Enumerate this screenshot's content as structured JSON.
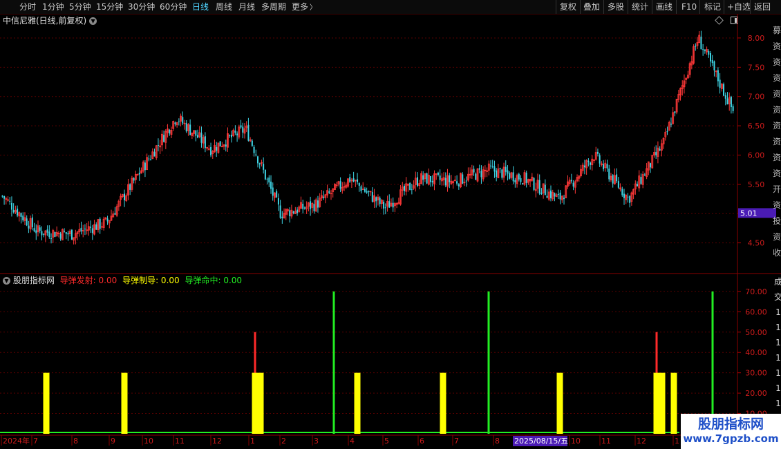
{
  "toolbar": {
    "periods": [
      "分时",
      "1分钟",
      "5分钟",
      "15分钟",
      "30分钟",
      "60分钟",
      "日线",
      "周线",
      "月线",
      "多周期",
      "更多"
    ],
    "active_period": "日线",
    "right_buttons": [
      "复权",
      "叠加",
      "多股",
      "统计",
      "画线",
      "F10",
      "标记",
      "+自选",
      "返回"
    ]
  },
  "main_chart": {
    "title": "中信尼雅(日线,前复权)",
    "current_price_tag": "5.01",
    "price_axis_labels": [
      "8.00",
      "7.50",
      "7.00",
      "6.50",
      "6.00",
      "5.50",
      "5.00",
      "4.50"
    ],
    "right_edge_glyphs": [
      "募",
      "资",
      "资",
      "资",
      "资",
      "资",
      "资",
      "资",
      "资",
      "资",
      "开",
      "资",
      "投",
      "资",
      "收"
    ]
  },
  "indicator": {
    "name": "股朋指标网",
    "lines": [
      {
        "label": "导弹发射: 0.00",
        "color": "#ff2a2a"
      },
      {
        "label": "导弹制导: 0.00",
        "color": "#ffff00"
      },
      {
        "label": "导弹命中: 0.00",
        "color": "#22ee22"
      }
    ],
    "axis_labels": [
      "70.00",
      "60.00",
      "50.00",
      "40.00",
      "30.00",
      "20.00",
      "10.00"
    ],
    "right_edge_glyphs": [
      "成",
      "交",
      "1",
      "1",
      "1",
      "1",
      "1",
      "1",
      "1",
      "1",
      "1"
    ]
  },
  "time_axis": {
    "labels": [
      "2024年",
      "7",
      "8",
      "9",
      "10",
      "11",
      "12",
      "1",
      "2",
      "3",
      "4",
      "5",
      "6",
      "7",
      "8",
      "9",
      "10",
      "11",
      "12",
      "1"
    ],
    "cursor_date": "2025/08/15/五"
  },
  "chart_data": [
    {
      "type": "candlestick",
      "title": "中信尼雅(日线,前复权)",
      "ylim": [
        4.0,
        8.2
      ],
      "approx_close_path": [
        {
          "t": "2024-06",
          "v": 5.3
        },
        {
          "t": "2024-07",
          "v": 4.7
        },
        {
          "t": "2024-08",
          "v": 4.65
        },
        {
          "t": "2024-09",
          "v": 4.85
        },
        {
          "t": "2024-10",
          "v": 5.75
        },
        {
          "t": "2024-10-end",
          "v": 6.65
        },
        {
          "t": "2024-11",
          "v": 6.1
        },
        {
          "t": "2024-12",
          "v": 6.45
        },
        {
          "t": "2025-01",
          "v": 5.0
        },
        {
          "t": "2025-02",
          "v": 5.15
        },
        {
          "t": "2025-03",
          "v": 5.6
        },
        {
          "t": "2025-04",
          "v": 5.1
        },
        {
          "t": "2025-05",
          "v": 5.6
        },
        {
          "t": "2025-06",
          "v": 5.55
        },
        {
          "t": "2025-07",
          "v": 5.75
        },
        {
          "t": "2025-08",
          "v": 5.6
        },
        {
          "t": "2025-09",
          "v": 5.25
        },
        {
          "t": "2025-10",
          "v": 6.0
        },
        {
          "t": "2025-11",
          "v": 5.25
        },
        {
          "t": "2025-12",
          "v": 6.2
        },
        {
          "t": "2026-01",
          "v": 8.0
        },
        {
          "t": "2026-01-end",
          "v": 6.75
        }
      ]
    },
    {
      "type": "bar",
      "title": "股朋指标网",
      "ylim": [
        0,
        72
      ],
      "series": [
        {
          "name": "导弹发射",
          "color": "#ff2a2a",
          "events": [
            {
              "t": "2025-01",
              "v": 50
            },
            {
              "t": "2025-12",
              "v": 50
            }
          ]
        },
        {
          "name": "导弹制导",
          "color": "#ffff00",
          "events": [
            {
              "t": "2024-07",
              "v": 30
            },
            {
              "t": "2024-09",
              "v": 30
            },
            {
              "t": "2025-01",
              "v": 30
            },
            {
              "t": "2025-04",
              "v": 30
            },
            {
              "t": "2025-06",
              "v": 30
            },
            {
              "t": "2025-09",
              "v": 30
            },
            {
              "t": "2025-12",
              "v": 30
            },
            {
              "t": "2026-01",
              "v": 30
            }
          ]
        },
        {
          "name": "导弹命中",
          "color": "#22ee22",
          "events": [
            {
              "t": "2025-03",
              "v": 70
            },
            {
              "t": "2025-08",
              "v": 70
            },
            {
              "t": "2026-01",
              "v": 70
            }
          ]
        }
      ]
    }
  ],
  "watermark": {
    "main": "股朋指标网",
    "url": "www.7gpzb.com"
  }
}
